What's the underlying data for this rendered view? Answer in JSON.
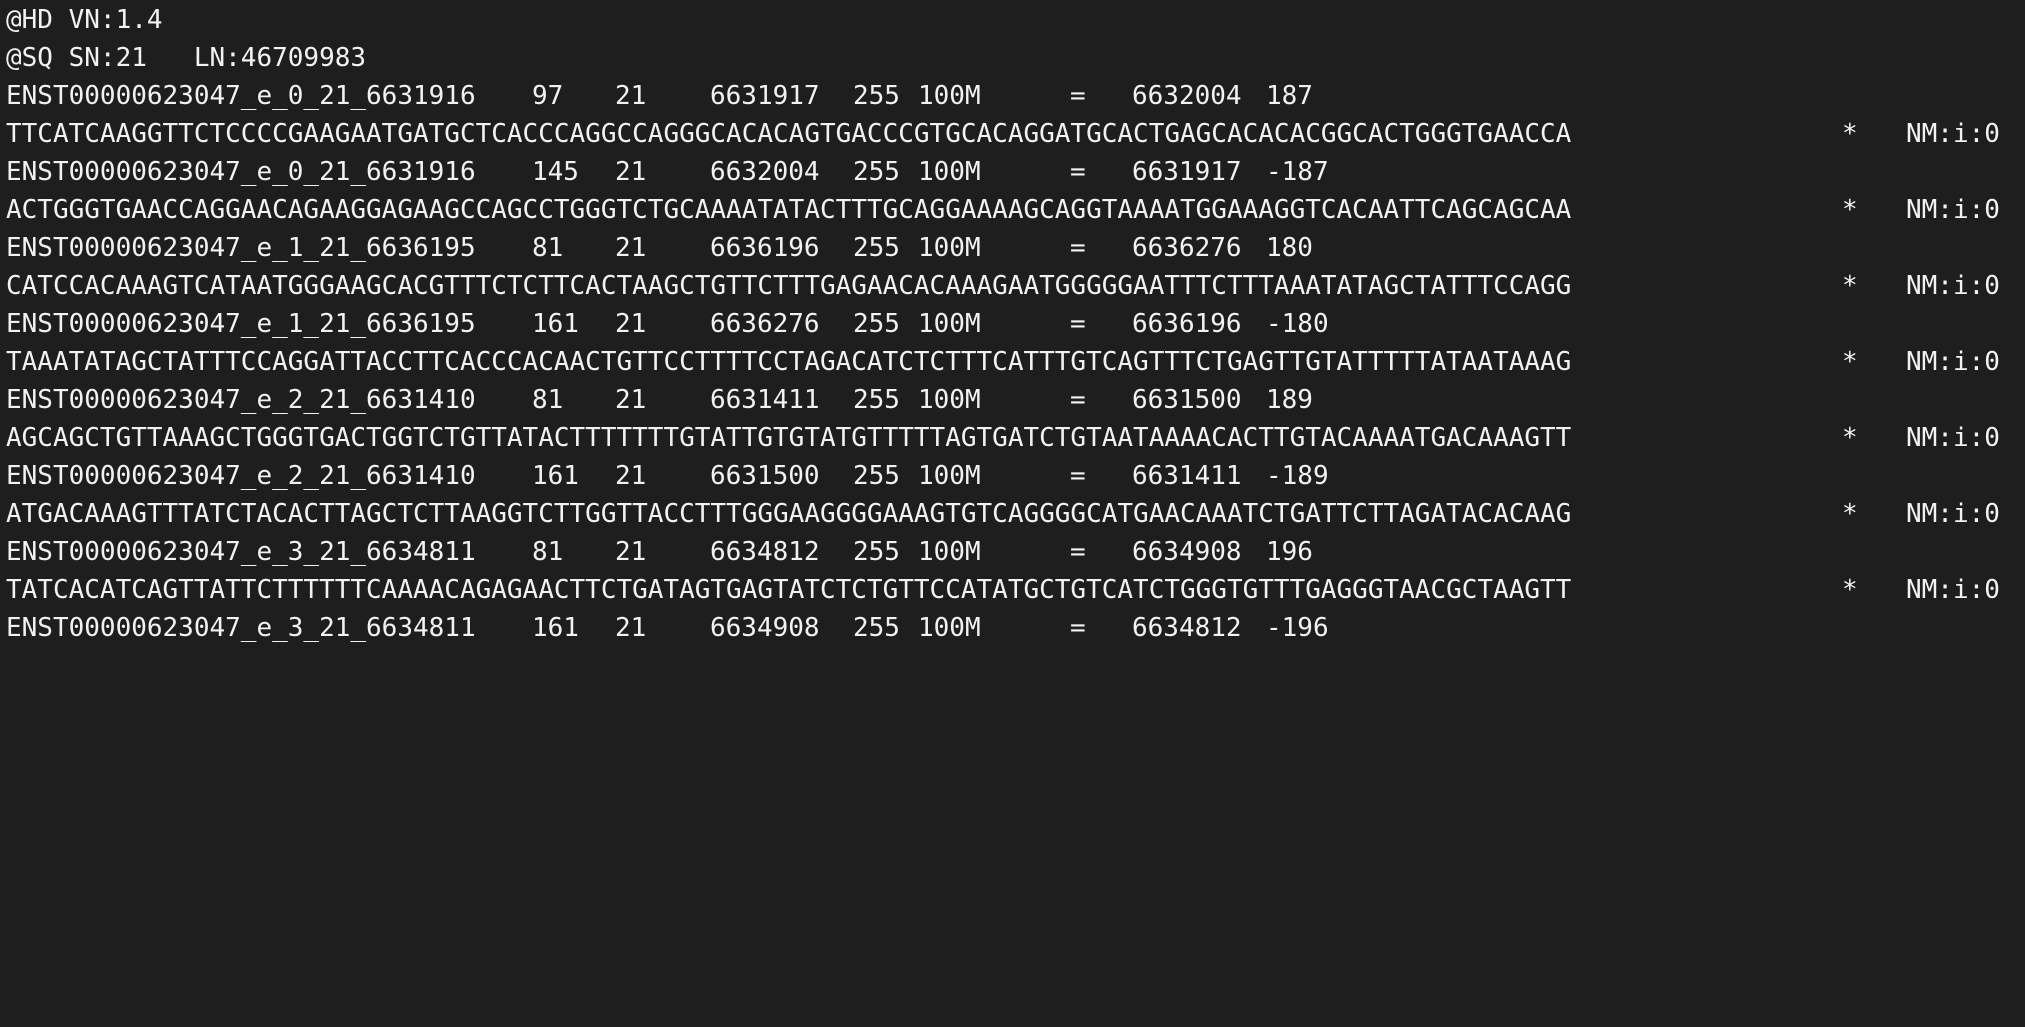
{
  "header": [
    "@HD VN:1.4",
    "@SQ SN:21   LN:46709983"
  ],
  "records": [
    {
      "qname": "ENST00000623047_e_0_21_6631916",
      "flag": "97",
      "rname": "21",
      "pos": "6631917",
      "mapq": "255",
      "cigar": "100M",
      "rnext": "=",
      "pnext": "6632004",
      "tlen": "187",
      "seq": "TTCATCAAGGTTCTCCCCGAAGAATGATGCTCACCCAGGCCAGGGCACACAGTGACCCGTGCACAGGATGCACTGAGCACACACGGCACTGGGTGAACCA",
      "qual": "*",
      "tag": "NM:i:0"
    },
    {
      "qname": "ENST00000623047_e_0_21_6631916",
      "flag": "145",
      "rname": "21",
      "pos": "6632004",
      "mapq": "255",
      "cigar": "100M",
      "rnext": "=",
      "pnext": "6631917",
      "tlen": "-187",
      "seq": "ACTGGGTGAACCAGGAACAGAAGGAGAAGCCAGCCTGGGTCTGCAAAATATACTTTGCAGGAAAAGCAGGTAAAATGGAAAGGTCACAATTCAGCAGCAA",
      "qual": "*",
      "tag": "NM:i:0"
    },
    {
      "qname": "ENST00000623047_e_1_21_6636195",
      "flag": "81",
      "rname": "21",
      "pos": "6636196",
      "mapq": "255",
      "cigar": "100M",
      "rnext": "=",
      "pnext": "6636276",
      "tlen": "180",
      "seq": "CATCCACAAAGTCATAATGGGAAGCACGTTTCTCTTCACTAAGCTGTTCTTTGAGAACACAAAGAATGGGGGAATTTCTTTAAATATAGCTATTTCCAGG",
      "qual": "*",
      "tag": "NM:i:0"
    },
    {
      "qname": "ENST00000623047_e_1_21_6636195",
      "flag": "161",
      "rname": "21",
      "pos": "6636276",
      "mapq": "255",
      "cigar": "100M",
      "rnext": "=",
      "pnext": "6636196",
      "tlen": "-180",
      "seq": "TAAATATAGCTATTTCCAGGATTACCTTCACCCACAACTGTTCCTTTTCCTAGACATCTCTTTCATTTGTCAGTTTCTGAGTTGTATTTTTATAATAAAG",
      "qual": "*",
      "tag": "NM:i:0"
    },
    {
      "qname": "ENST00000623047_e_2_21_6631410",
      "flag": "81",
      "rname": "21",
      "pos": "6631411",
      "mapq": "255",
      "cigar": "100M",
      "rnext": "=",
      "pnext": "6631500",
      "tlen": "189",
      "seq": "AGCAGCTGTTAAAGCTGGGTGACTGGTCTGTTATACTTTTTTTGTATTGTGTATGTTTTTAGTGATCTGTAATAAAACACTTGTACAAAATGACAAAGTT",
      "qual": "*",
      "tag": "NM:i:0"
    },
    {
      "qname": "ENST00000623047_e_2_21_6631410",
      "flag": "161",
      "rname": "21",
      "pos": "6631500",
      "mapq": "255",
      "cigar": "100M",
      "rnext": "=",
      "pnext": "6631411",
      "tlen": "-189",
      "seq": "ATGACAAAGTTTATCTACACTTAGCTCTTAAGGTCTTGGTTACCTTTGGGAAGGGGAAAGTGTCAGGGGCATGAACAAATCTGATTCTTAGATACACAAG",
      "qual": "*",
      "tag": "NM:i:0"
    },
    {
      "qname": "ENST00000623047_e_3_21_6634811",
      "flag": "81",
      "rname": "21",
      "pos": "6634812",
      "mapq": "255",
      "cigar": "100M",
      "rnext": "=",
      "pnext": "6634908",
      "tlen": "196",
      "seq": "TATCACATCAGTTATTCTTTTTTCAAAACAGAGAACTTCTGATAGTGAGTATCTCTGTTCCATATGCTGTCATCTGGGTGTTTGAGGGTAACGCTAAGTT",
      "qual": "*",
      "tag": "NM:i:0"
    },
    {
      "qname": "ENST00000623047_e_3_21_6634811",
      "flag": "161",
      "rname": "21",
      "pos": "6634908",
      "mapq": "255",
      "cigar": "100M",
      "rnext": "=",
      "pnext": "6634812",
      "tlen": "-196"
    }
  ]
}
